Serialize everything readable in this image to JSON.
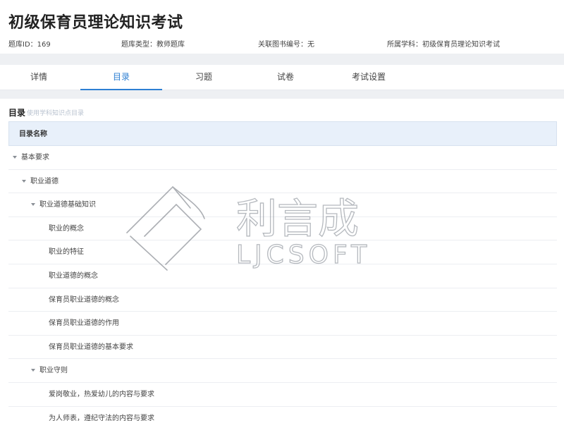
{
  "header": {
    "title": "初级保育员理论知识考试",
    "bank_id": "题库ID：169",
    "bank_type": "题库类型：教师题库",
    "book_no": "关联图书编号：无",
    "subject": "所属学科：初级保育员理论知识考试"
  },
  "tabs": [
    "详情",
    "目录",
    "习题",
    "试卷",
    "考试设置"
  ],
  "catalog": {
    "title": "目录",
    "hint": "使用学科知识点目录",
    "column_header": "目录名称"
  },
  "rows": [
    {
      "label": "基本要求",
      "level": 0,
      "expandable": true
    },
    {
      "label": "职业道德",
      "level": 1,
      "expandable": true
    },
    {
      "label": "职业道德基础知识",
      "level": 2,
      "expandable": true
    },
    {
      "label": "职业的概念",
      "level": 3,
      "expandable": false
    },
    {
      "label": "职业的特征",
      "level": 3,
      "expandable": false
    },
    {
      "label": "职业道德的概念",
      "level": 3,
      "expandable": false
    },
    {
      "label": "保育员职业道德的概念",
      "level": 3,
      "expandable": false
    },
    {
      "label": "保育员职业道德的作用",
      "level": 3,
      "expandable": false
    },
    {
      "label": "保育员职业道德的基本要求",
      "level": 3,
      "expandable": false
    },
    {
      "label": "职业守则",
      "level": 2,
      "expandable": true
    },
    {
      "label": "爱岗敬业，热爱幼儿的内容与要求",
      "level": 3,
      "expandable": false
    },
    {
      "label": "为人师表，遵纪守法的内容与要求",
      "level": 3,
      "expandable": false
    }
  ],
  "watermark": {
    "cn": "利言成",
    "en": "LJCSOFT"
  }
}
